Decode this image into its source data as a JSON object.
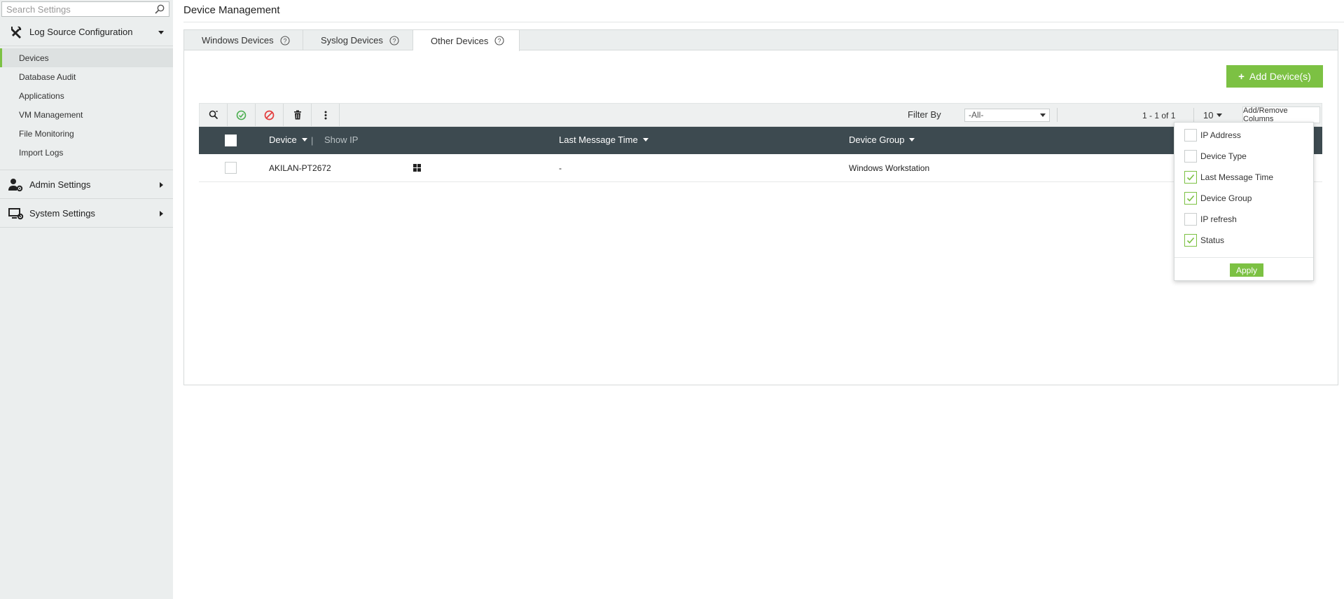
{
  "colors": {
    "accent": "#7cc143",
    "header_bg": "#3d4a50",
    "sidebar_bg": "#ebeeee",
    "danger": "#e33d3d"
  },
  "sidebar": {
    "search": {
      "placeholder": "Search Settings",
      "value": ""
    },
    "groups": [
      {
        "label": "Log Source Configuration",
        "icon": "tools-icon",
        "expanded": true
      },
      {
        "label": "Admin Settings",
        "icon": "admin-user-gear-icon",
        "expanded": false
      },
      {
        "label": "System Settings",
        "icon": "monitor-gear-icon",
        "expanded": false
      }
    ],
    "items": [
      {
        "label": "Devices",
        "active": true
      },
      {
        "label": "Database Audit"
      },
      {
        "label": "Applications"
      },
      {
        "label": "VM Management"
      },
      {
        "label": "File Monitoring"
      },
      {
        "label": "Import Logs"
      }
    ]
  },
  "main": {
    "title": "Device Management",
    "tabs": [
      {
        "label": "Windows Devices",
        "active": false
      },
      {
        "label": "Syslog Devices",
        "active": false
      },
      {
        "label": "Other Devices",
        "active": true
      }
    ],
    "add_button": "Add Device(s)",
    "toolbar": {
      "icons": [
        "search-filter-icon",
        "enable-check-icon",
        "disable-icon",
        "delete-trash-icon",
        "more-vertical-icon"
      ],
      "filter_label": "Filter By",
      "filter_value": "-All-",
      "pager_range": "1 - 1 of 1",
      "page_size": "10",
      "columns_button": "Add/Remove Columns"
    },
    "table": {
      "columns": {
        "device": "Device",
        "separator": "|",
        "show_ip": "Show IP",
        "last_message": "Last Message Time",
        "device_group": "Device Group"
      },
      "rows": [
        {
          "device": "AKILAN-PT2672",
          "os_icon": "windows-icon",
          "last_message": "-",
          "device_group": "Windows Workstation"
        }
      ]
    },
    "columns_dropdown": {
      "options": [
        {
          "label": "IP Address",
          "checked": false
        },
        {
          "label": "Device Type",
          "checked": false
        },
        {
          "label": "Last Message Time",
          "checked": true
        },
        {
          "label": "Device Group",
          "checked": true
        },
        {
          "label": "IP refresh",
          "checked": false
        },
        {
          "label": "Status",
          "checked": true
        }
      ],
      "apply": "Apply"
    }
  }
}
